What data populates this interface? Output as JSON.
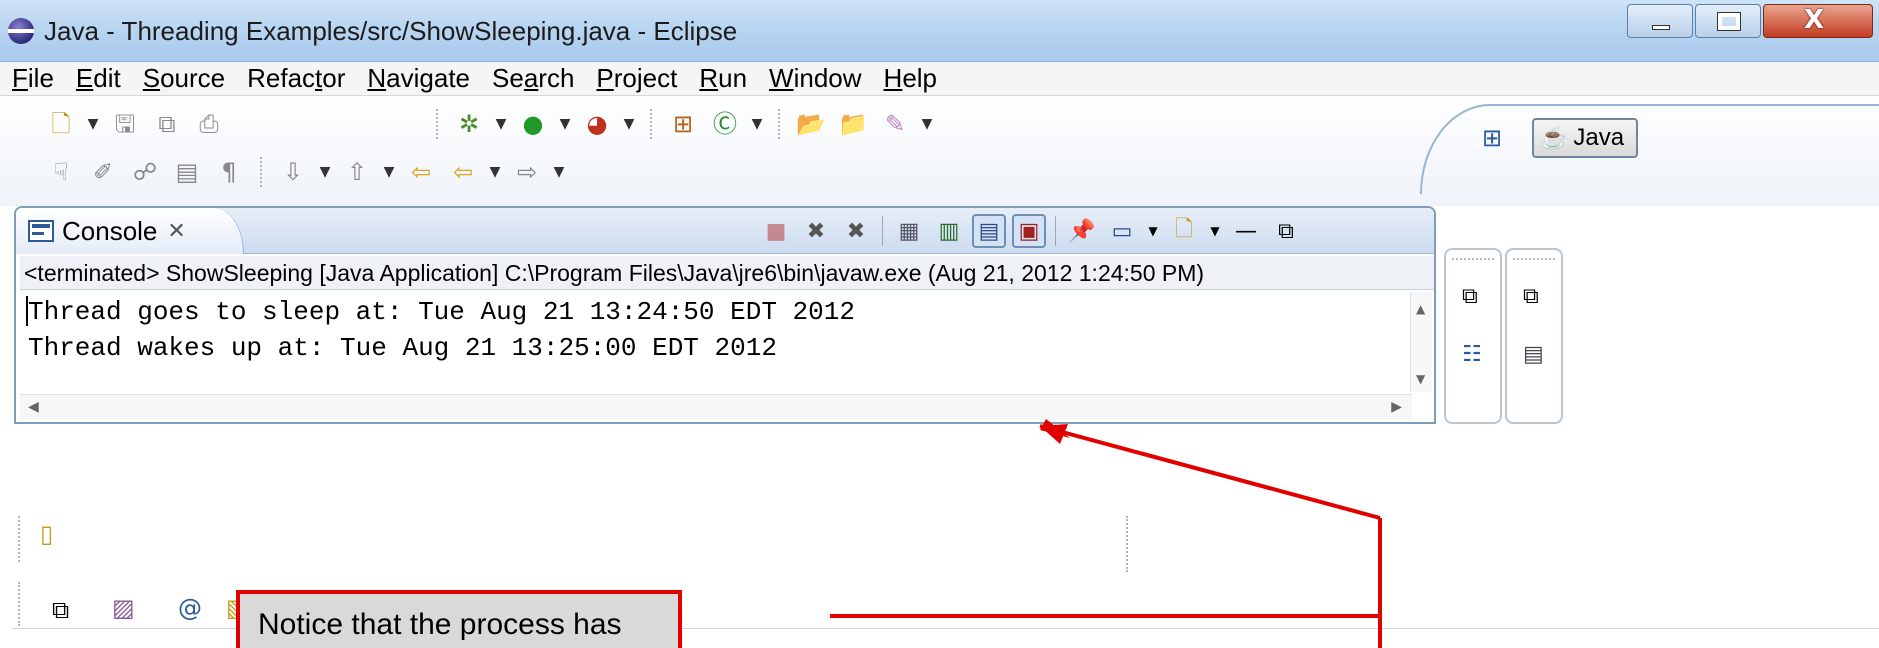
{
  "window": {
    "title": "Java - Threading Examples/src/ShowSleeping.java - Eclipse",
    "controls": {
      "minimize_icon": "minimize-icon",
      "maximize_icon": "maximize-icon",
      "close_icon": "close-icon",
      "close_glyph": "X"
    }
  },
  "menu": {
    "items": [
      {
        "pre": "",
        "u": "F",
        "post": "ile"
      },
      {
        "pre": "",
        "u": "E",
        "post": "dit"
      },
      {
        "pre": "",
        "u": "S",
        "post": "ource"
      },
      {
        "pre": "Refac",
        "u": "t",
        "post": "or"
      },
      {
        "pre": "",
        "u": "N",
        "post": "avigate"
      },
      {
        "pre": "Se",
        "u": "a",
        "post": "rch"
      },
      {
        "pre": "",
        "u": "P",
        "post": "roject"
      },
      {
        "pre": "",
        "u": "R",
        "post": "un"
      },
      {
        "pre": "",
        "u": "W",
        "post": "indow"
      },
      {
        "pre": "",
        "u": "H",
        "post": "elp"
      }
    ]
  },
  "perspective": {
    "label": "Java"
  },
  "console": {
    "tab_label": "Console",
    "tab_close_glyph": "✕",
    "terminated_line": "<terminated> ShowSleeping [Java Application] C:\\Program Files\\Java\\jre6\\bin\\javaw.exe (Aug 21, 2012 1:24:50 PM)",
    "output": [
      "Thread goes to sleep at: Tue Aug 21 13:24:50 EDT 2012",
      "Thread wakes up at: Tue Aug 21 13:25:00 EDT 2012"
    ]
  },
  "annotation": {
    "text": "Notice that the process has",
    "color": "#e00000"
  }
}
